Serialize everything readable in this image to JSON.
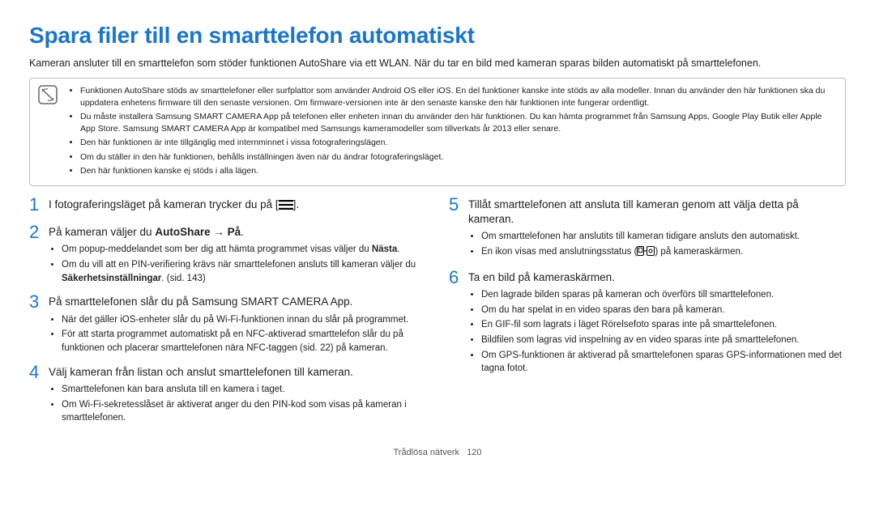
{
  "title": "Spara filer till en smarttelefon automatiskt",
  "intro": "Kameran ansluter till en smarttelefon som stöder funktionen AutoShare via ett WLAN. När du tar en bild med kameran sparas bilden automatiskt på smarttelefonen.",
  "notebox": {
    "icon_name": "note-icon",
    "items": [
      "Funktionen AutoShare stöds av smarttelefoner eller surfplattor som använder Android OS eller iOS. En del funktioner kanske inte stöds av alla modeller. Innan du använder den här funktionen ska du uppdatera enhetens firmware till den senaste versionen. Om firmware-versionen inte är den senaste kanske den här funktionen inte fungerar ordentligt.",
      "Du måste installera Samsung SMART CAMERA App på telefonen eller enheten innan du använder den här funktionen. Du kan hämta programmet från Samsung Apps, Google Play Butik eller Apple App Store. Samsung SMART CAMERA App är kompatibel med Samsungs kameramodeller som tillverkats år 2013 eller senare.",
      "Den här funktionen är inte tillgänglig med internminnet i vissa fotograferingslägen.",
      "Om du ställer in den här funktionen, behålls inställningen även när du ändrar fotograferingsläget.",
      "Den här funktionen kanske ej stöds i alla lägen."
    ]
  },
  "left": {
    "step1": {
      "num": "1",
      "text_before": "I fotograferingsläget på kameran trycker du på [",
      "icon": "m",
      "text_after": "]."
    },
    "step2": {
      "num": "2",
      "pre": "På kameran väljer du ",
      "b1": "AutoShare",
      "mid": " ",
      "arrow": "→",
      "b2": "På",
      "post": ".",
      "subs": [
        {
          "pre": "Om popup-meddelandet som ber dig att hämta programmet visas väljer du ",
          "bold": "Nästa",
          "post": "."
        },
        {
          "pre": "Om du vill att en PIN-verifiering krävs när smarttelefonen ansluts till kameran väljer du ",
          "bold": "Säkerhetsinställningar",
          "post": ". (sid. 143)"
        }
      ]
    },
    "step3": {
      "num": "3",
      "main": "På smarttelefonen slår du på Samsung SMART CAMERA App.",
      "subs": [
        "När det gäller iOS-enheter slår du på Wi-Fi-funktionen innan du slår på programmet.",
        "För att starta programmet automatiskt på en NFC-aktiverad smarttelefon slår du på funktionen och placerar smarttelefonen nära NFC-taggen (sid. 22) på kameran."
      ]
    },
    "step4": {
      "num": "4",
      "main": "Välj kameran från listan och anslut smarttelefonen till kameran.",
      "subs": [
        "Smarttelefonen kan bara ansluta till en kamera i taget.",
        "Om Wi-Fi-sekretesslåset är aktiverat anger du den PIN-kod som visas på kameran i smarttelefonen."
      ]
    }
  },
  "right": {
    "step5": {
      "num": "5",
      "main": "Tillåt smarttelefonen att ansluta till kameran genom att välja detta på kameran.",
      "subs_plain": "Om smarttelefonen har anslutits till kameran tidigare ansluts den automatiskt.",
      "icon_line_pre": "En ikon visas med anslutningsstatus (",
      "icon_line_post": ") på kameraskärmen."
    },
    "step6": {
      "num": "6",
      "main": "Ta en bild på kameraskärmen.",
      "subs": [
        "Den lagrade bilden sparas på kameran och överförs till smarttelefonen.",
        "Om du har spelat in en video sparas den bara på kameran.",
        "En GIF-fil som lagrats i läget Rörelsefoto sparas inte på smarttelefonen.",
        "Bildfilen som lagras vid inspelning av en video sparas inte på smarttelefonen.",
        "Om GPS-funktionen är aktiverad på smarttelefonen sparas GPS-informationen med det tagna fotot."
      ]
    }
  },
  "footer": {
    "label": "Trådlösa nätverk",
    "page": "120"
  }
}
